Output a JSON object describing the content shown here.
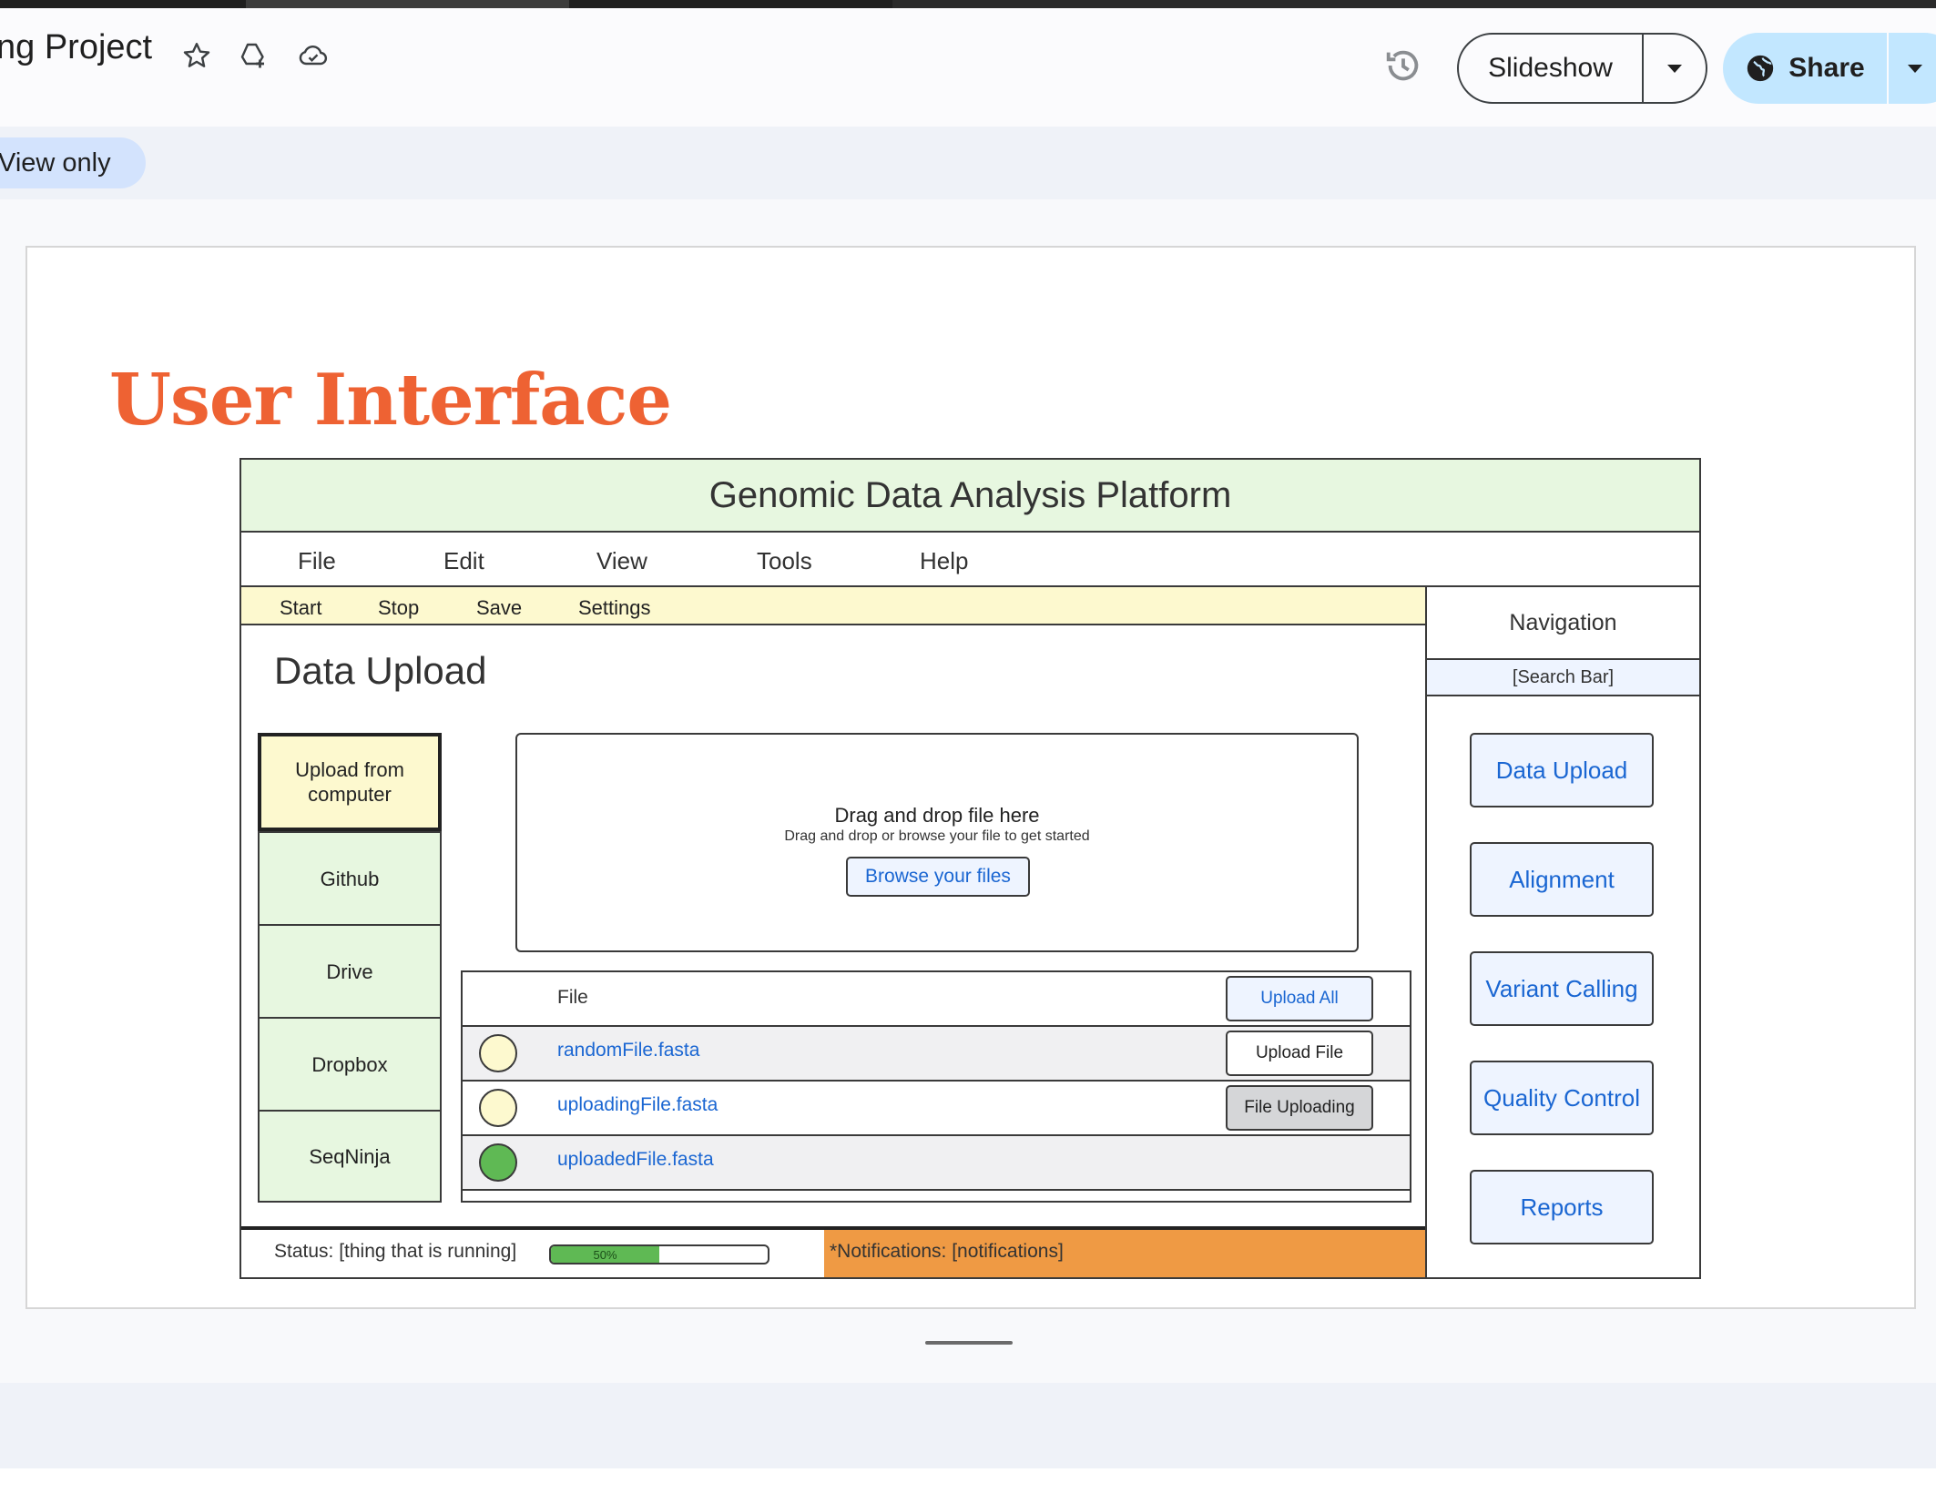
{
  "document": {
    "title": "ng Project"
  },
  "header": {
    "slideshow_label": "Slideshow",
    "share_label": "Share",
    "icons": [
      "star-icon",
      "drive-add-icon",
      "cloud-done-icon",
      "history-icon",
      "globe-icon"
    ]
  },
  "mode": {
    "label": "View only"
  },
  "slide": {
    "title": "User Interface",
    "title_color": "#ee6233"
  },
  "mockup": {
    "app_title": "Genomic Data Analysis Platform",
    "menu": [
      "File",
      "Edit",
      "View",
      "Tools",
      "Help"
    ],
    "toolbar": [
      "Start",
      "Stop",
      "Save",
      "Settings"
    ],
    "section_title": "Data Upload",
    "sources": [
      "Upload from computer",
      "Github",
      "Drive",
      "Dropbox",
      "SeqNinja"
    ],
    "active_source": "Upload from computer",
    "dropzone": {
      "heading": "Drag and drop file here",
      "subtext": "Drag and drop or browse your file to get started",
      "browse_label": "Browse your files"
    },
    "file_table": {
      "column_header": "File",
      "upload_all_label": "Upload All",
      "rows": [
        {
          "name": "randomFile.fasta",
          "status_color": "#fdf9cf",
          "action": "Upload File"
        },
        {
          "name": "uploadingFile.fasta",
          "status_color": "#fdf9cf",
          "action": "File Uploading"
        },
        {
          "name": "uploadedFile.fasta",
          "status_color": "#5fb954",
          "action": ""
        }
      ]
    },
    "navigation": {
      "title": "Navigation",
      "search": "[Search Bar]",
      "items": [
        "Data Upload",
        "Alignment",
        "Variant Calling",
        "Quality Control",
        "Reports"
      ]
    },
    "status": {
      "text": "Status: [thing that is running]",
      "progress_percent": 50,
      "progress_label": "50%",
      "notifications": "*Notifications: [notifications]"
    },
    "colors": {
      "green_panel": "#e7f7e0",
      "yellow_panel": "#fdf9cf",
      "blue_button": "#eef4ff",
      "link_blue": "#1a66d2",
      "notification_orange": "#ef9a44"
    }
  }
}
